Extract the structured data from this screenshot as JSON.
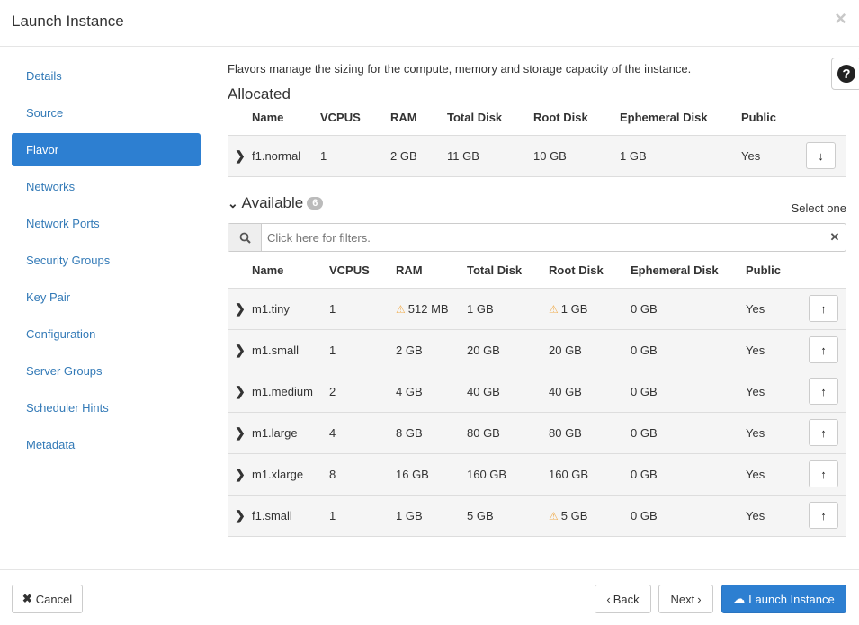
{
  "header": {
    "title": "Launch Instance",
    "close": "×"
  },
  "sidebar": {
    "items": [
      {
        "label": "Details"
      },
      {
        "label": "Source"
      },
      {
        "label": "Flavor"
      },
      {
        "label": "Networks"
      },
      {
        "label": "Network Ports"
      },
      {
        "label": "Security Groups"
      },
      {
        "label": "Key Pair"
      },
      {
        "label": "Configuration"
      },
      {
        "label": "Server Groups"
      },
      {
        "label": "Scheduler Hints"
      },
      {
        "label": "Metadata"
      }
    ],
    "active": "Flavor"
  },
  "main": {
    "description": "Flavors manage the sizing for the compute, memory and storage capacity of the instance.",
    "help": "?",
    "allocated": {
      "title": "Allocated",
      "columns": [
        "Name",
        "VCPUS",
        "RAM",
        "Total Disk",
        "Root Disk",
        "Ephemeral Disk",
        "Public"
      ],
      "rows": [
        {
          "name": "f1.normal",
          "vcpus": "1",
          "ram": "2 GB",
          "total_disk": "11 GB",
          "root_disk": "10 GB",
          "ephemeral": "1 GB",
          "public": "Yes"
        }
      ]
    },
    "available": {
      "title": "Available",
      "count": "6",
      "select_one": "Select one",
      "filter_placeholder": "Click here for filters.",
      "columns": [
        "Name",
        "VCPUS",
        "RAM",
        "Total Disk",
        "Root Disk",
        "Ephemeral Disk",
        "Public"
      ],
      "rows": [
        {
          "name": "m1.tiny",
          "vcpus": "1",
          "ram": "512 MB",
          "total_disk": "1 GB",
          "root_disk": "1 GB",
          "ephemeral": "0 GB",
          "public": "Yes"
        },
        {
          "name": "m1.small",
          "vcpus": "1",
          "ram": "2 GB",
          "total_disk": "20 GB",
          "root_disk": "20 GB",
          "ephemeral": "0 GB",
          "public": "Yes"
        },
        {
          "name": "m1.medium",
          "vcpus": "2",
          "ram": "4 GB",
          "total_disk": "40 GB",
          "root_disk": "40 GB",
          "ephemeral": "0 GB",
          "public": "Yes"
        },
        {
          "name": "m1.large",
          "vcpus": "4",
          "ram": "8 GB",
          "total_disk": "80 GB",
          "root_disk": "80 GB",
          "ephemeral": "0 GB",
          "public": "Yes"
        },
        {
          "name": "m1.xlarge",
          "vcpus": "8",
          "ram": "16 GB",
          "total_disk": "160 GB",
          "root_disk": "160 GB",
          "ephemeral": "0 GB",
          "public": "Yes"
        },
        {
          "name": "f1.small",
          "vcpus": "1",
          "ram": "1 GB",
          "total_disk": "5 GB",
          "root_disk": "5 GB",
          "ephemeral": "0 GB",
          "public": "Yes"
        }
      ]
    }
  },
  "footer": {
    "cancel": "Cancel",
    "back": "Back",
    "next": "Next",
    "launch": "Launch Instance"
  },
  "colors": {
    "primary": "#2d7fd1",
    "warning": "#f0ad4e",
    "link": "#337ab7"
  }
}
